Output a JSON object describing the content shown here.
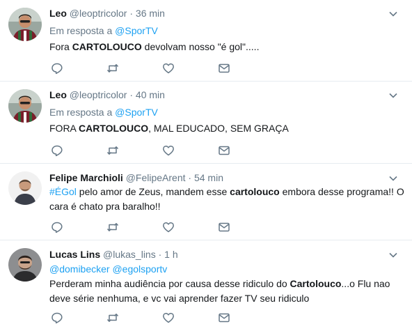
{
  "tweets": [
    {
      "name": "Leo",
      "handle": "@leoptricolor",
      "dot": "·",
      "time": "36 min",
      "reply_prefix": "Em resposta a ",
      "reply_to": "@SporTV",
      "text_before": "Fora ",
      "text_bold": "CARTOLOUCO",
      "text_after": " devolvam nosso \"é gol\"....."
    },
    {
      "name": "Leo",
      "handle": "@leoptricolor",
      "dot": "·",
      "time": "40 min",
      "reply_prefix": "Em resposta a ",
      "reply_to": "@SporTV",
      "text_before": "FORA ",
      "text_bold": "CARTOLOUCO",
      "text_after": ", MAL EDUCADO, SEM GRAÇA"
    },
    {
      "name": "Felipe Marchioli",
      "handle": "@FelipeArent",
      "dot": "·",
      "time": "54 min",
      "hashtag": "#ÉGol",
      "text_before": " pelo amor de Zeus, mandem esse ",
      "text_bold": "cartolouco",
      "text_after": " embora desse programa!! O cara é chato pra baralho!!"
    },
    {
      "name": "Lucas Lins",
      "handle": "@lukas_lins",
      "dot": "·",
      "time": "1 h",
      "mention1": "@domibecker",
      "mention2": "@egolsportv",
      "text_before": "Perderam minha audiência por causa desse ridiculo do ",
      "text_bold": "Cartolouco",
      "text_after": "...o Flu nao deve série nenhuma, e vc vai aprender fazer TV seu ridiculo"
    }
  ],
  "icons": {
    "reply": "reply-icon",
    "retweet": "retweet-icon",
    "like": "heart-icon",
    "message": "envelope-icon",
    "caret": "chevron-down-icon"
  },
  "colors": {
    "link": "#1da1f2",
    "secondary_text": "#657786",
    "divider": "#e6ecf0",
    "icon": "#657786"
  }
}
